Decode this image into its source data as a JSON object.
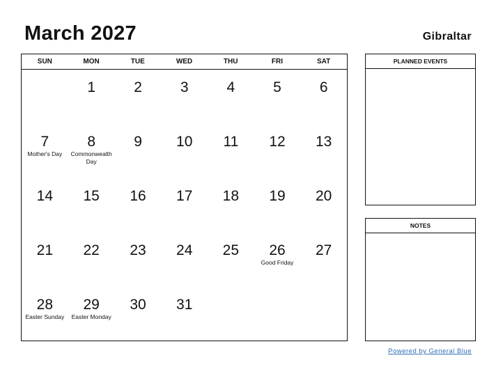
{
  "header": {
    "title": "March 2027",
    "country": "Gibraltar"
  },
  "calendar": {
    "weekdays": [
      "SUN",
      "MON",
      "TUE",
      "WED",
      "THU",
      "FRI",
      "SAT"
    ],
    "weeks": [
      [
        {
          "day": "",
          "holiday": ""
        },
        {
          "day": "1",
          "holiday": ""
        },
        {
          "day": "2",
          "holiday": ""
        },
        {
          "day": "3",
          "holiday": ""
        },
        {
          "day": "4",
          "holiday": ""
        },
        {
          "day": "5",
          "holiday": ""
        },
        {
          "day": "6",
          "holiday": ""
        }
      ],
      [
        {
          "day": "7",
          "holiday": "Mother's Day"
        },
        {
          "day": "8",
          "holiday": "Commonwealth Day"
        },
        {
          "day": "9",
          "holiday": ""
        },
        {
          "day": "10",
          "holiday": ""
        },
        {
          "day": "11",
          "holiday": ""
        },
        {
          "day": "12",
          "holiday": ""
        },
        {
          "day": "13",
          "holiday": ""
        }
      ],
      [
        {
          "day": "14",
          "holiday": ""
        },
        {
          "day": "15",
          "holiday": ""
        },
        {
          "day": "16",
          "holiday": ""
        },
        {
          "day": "17",
          "holiday": ""
        },
        {
          "day": "18",
          "holiday": ""
        },
        {
          "day": "19",
          "holiday": ""
        },
        {
          "day": "20",
          "holiday": ""
        }
      ],
      [
        {
          "day": "21",
          "holiday": ""
        },
        {
          "day": "22",
          "holiday": ""
        },
        {
          "day": "23",
          "holiday": ""
        },
        {
          "day": "24",
          "holiday": ""
        },
        {
          "day": "25",
          "holiday": ""
        },
        {
          "day": "26",
          "holiday": "Good Friday"
        },
        {
          "day": "27",
          "holiday": ""
        }
      ],
      [
        {
          "day": "28",
          "holiday": "Easter Sunday"
        },
        {
          "day": "29",
          "holiday": "Easter Monday"
        },
        {
          "day": "30",
          "holiday": ""
        },
        {
          "day": "31",
          "holiday": ""
        },
        {
          "day": "",
          "holiday": ""
        },
        {
          "day": "",
          "holiday": ""
        },
        {
          "day": "",
          "holiday": ""
        }
      ]
    ]
  },
  "panels": {
    "events_title": "PLANNED EVENTS",
    "notes_title": "NOTES"
  },
  "footer": {
    "powered_by": "Powered by General Blue",
    "link_color": "#2f6db3"
  }
}
